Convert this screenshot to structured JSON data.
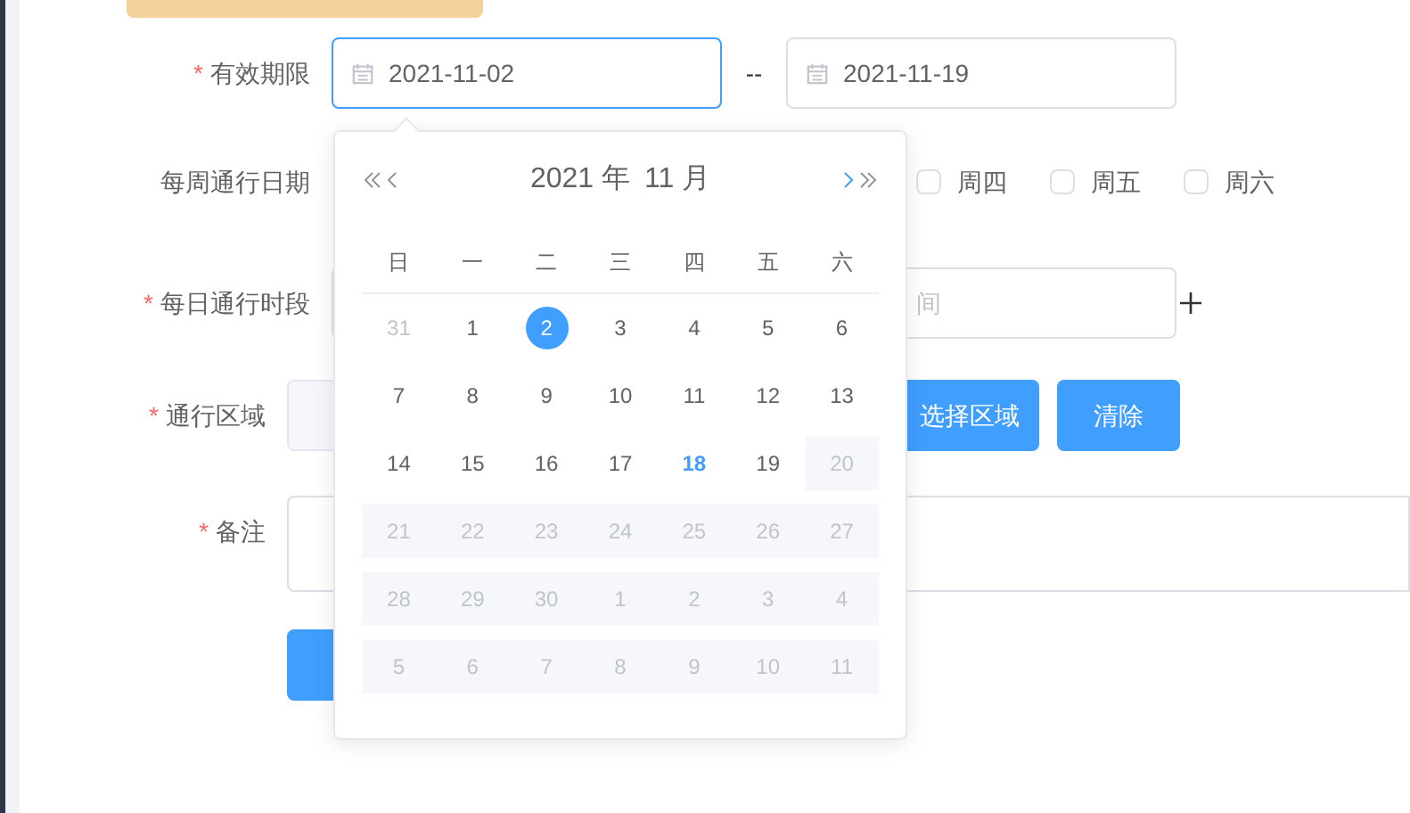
{
  "required_mark": "*",
  "validity": {
    "label": "有效期限",
    "required": true,
    "start": "2021-11-02",
    "start_focused": true,
    "separator": "--",
    "end": "2021-11-19"
  },
  "weekly": {
    "label": "每周通行日期",
    "required": false,
    "options": [
      {
        "label": "周四",
        "checked": false
      },
      {
        "label": "周五",
        "checked": false
      },
      {
        "label": "周六",
        "checked": false
      }
    ]
  },
  "daily": {
    "label": "每日通行时段",
    "required": true,
    "placeholder": "间"
  },
  "area": {
    "label": "通行区域",
    "required": true,
    "buttons": [
      "选择区域",
      "清除"
    ]
  },
  "remarks": {
    "label": "备注",
    "required": true
  },
  "calendar": {
    "year": "2021 年",
    "month": "11 月",
    "weekdays": [
      "日",
      "一",
      "二",
      "三",
      "四",
      "五",
      "六"
    ],
    "weeks": [
      [
        {
          "day": "31",
          "kind": "prev",
          "disabled": false,
          "selected": false,
          "today": false
        },
        {
          "day": "1",
          "kind": "current",
          "disabled": false,
          "selected": false,
          "today": false
        },
        {
          "day": "2",
          "kind": "current",
          "disabled": false,
          "selected": true,
          "today": false
        },
        {
          "day": "3",
          "kind": "current",
          "disabled": false,
          "selected": false,
          "today": false
        },
        {
          "day": "4",
          "kind": "current",
          "disabled": false,
          "selected": false,
          "today": false
        },
        {
          "day": "5",
          "kind": "current",
          "disabled": false,
          "selected": false,
          "today": false
        },
        {
          "day": "6",
          "kind": "current",
          "disabled": false,
          "selected": false,
          "today": false
        }
      ],
      [
        {
          "day": "7",
          "kind": "current",
          "disabled": false,
          "selected": false,
          "today": false
        },
        {
          "day": "8",
          "kind": "current",
          "disabled": false,
          "selected": false,
          "today": false
        },
        {
          "day": "9",
          "kind": "current",
          "disabled": false,
          "selected": false,
          "today": false
        },
        {
          "day": "10",
          "kind": "current",
          "disabled": false,
          "selected": false,
          "today": false
        },
        {
          "day": "11",
          "kind": "current",
          "disabled": false,
          "selected": false,
          "today": false
        },
        {
          "day": "12",
          "kind": "current",
          "disabled": false,
          "selected": false,
          "today": false
        },
        {
          "day": "13",
          "kind": "current",
          "disabled": false,
          "selected": false,
          "today": false
        }
      ],
      [
        {
          "day": "14",
          "kind": "current",
          "disabled": false,
          "selected": false,
          "today": false
        },
        {
          "day": "15",
          "kind": "current",
          "disabled": false,
          "selected": false,
          "today": false
        },
        {
          "day": "16",
          "kind": "current",
          "disabled": false,
          "selected": false,
          "today": false
        },
        {
          "day": "17",
          "kind": "current",
          "disabled": false,
          "selected": false,
          "today": false
        },
        {
          "day": "18",
          "kind": "current",
          "disabled": false,
          "selected": false,
          "today": true
        },
        {
          "day": "19",
          "kind": "current",
          "disabled": false,
          "selected": false,
          "today": false
        },
        {
          "day": "20",
          "kind": "current",
          "disabled": true,
          "selected": false,
          "today": false
        }
      ],
      [
        {
          "day": "21",
          "kind": "current",
          "disabled": true,
          "selected": false,
          "today": false
        },
        {
          "day": "22",
          "kind": "current",
          "disabled": true,
          "selected": false,
          "today": false
        },
        {
          "day": "23",
          "kind": "current",
          "disabled": true,
          "selected": false,
          "today": false
        },
        {
          "day": "24",
          "kind": "current",
          "disabled": true,
          "selected": false,
          "today": false
        },
        {
          "day": "25",
          "kind": "current",
          "disabled": true,
          "selected": false,
          "today": false
        },
        {
          "day": "26",
          "kind": "current",
          "disabled": true,
          "selected": false,
          "today": false
        },
        {
          "day": "27",
          "kind": "current",
          "disabled": true,
          "selected": false,
          "today": false
        }
      ],
      [
        {
          "day": "28",
          "kind": "current",
          "disabled": true,
          "selected": false,
          "today": false
        },
        {
          "day": "29",
          "kind": "current",
          "disabled": true,
          "selected": false,
          "today": false
        },
        {
          "day": "30",
          "kind": "current",
          "disabled": true,
          "selected": false,
          "today": false
        },
        {
          "day": "1",
          "kind": "next",
          "disabled": true,
          "selected": false,
          "today": false
        },
        {
          "day": "2",
          "kind": "next",
          "disabled": true,
          "selected": false,
          "today": false
        },
        {
          "day": "3",
          "kind": "next",
          "disabled": true,
          "selected": false,
          "today": false
        },
        {
          "day": "4",
          "kind": "next",
          "disabled": true,
          "selected": false,
          "today": false
        }
      ],
      [
        {
          "day": "5",
          "kind": "next",
          "disabled": true,
          "selected": false,
          "today": false
        },
        {
          "day": "6",
          "kind": "next",
          "disabled": true,
          "selected": false,
          "today": false
        },
        {
          "day": "7",
          "kind": "next",
          "disabled": true,
          "selected": false,
          "today": false
        },
        {
          "day": "8",
          "kind": "next",
          "disabled": true,
          "selected": false,
          "today": false
        },
        {
          "day": "9",
          "kind": "next",
          "disabled": true,
          "selected": false,
          "today": false
        },
        {
          "day": "10",
          "kind": "next",
          "disabled": true,
          "selected": false,
          "today": false
        },
        {
          "day": "11",
          "kind": "next",
          "disabled": true,
          "selected": false,
          "today": false
        }
      ]
    ]
  }
}
